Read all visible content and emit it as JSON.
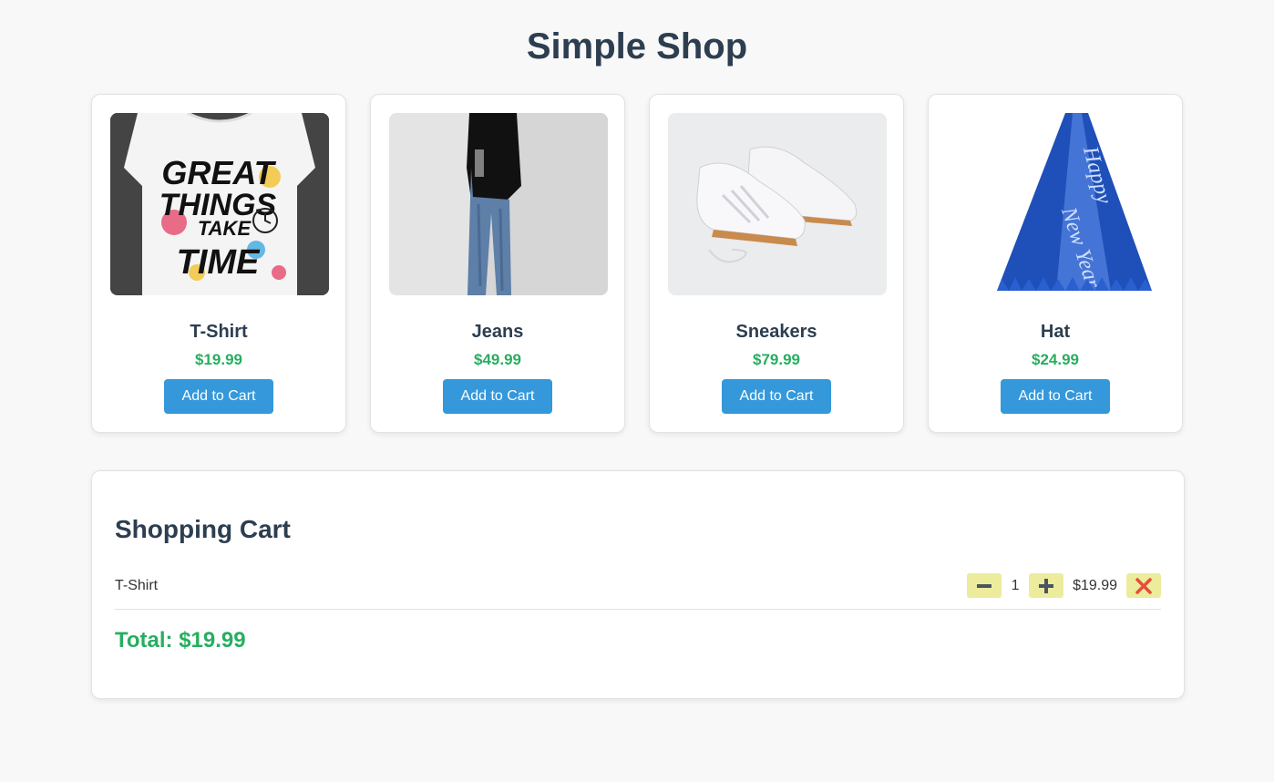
{
  "shop": {
    "title": "Simple Shop"
  },
  "products": [
    {
      "name": "T-Shirt",
      "price": "$19.99",
      "button": "Add to Cart",
      "image_text": [
        "GREAT",
        "THINGS",
        "TAKE",
        "TIME"
      ]
    },
    {
      "name": "Jeans",
      "price": "$49.99",
      "button": "Add to Cart"
    },
    {
      "name": "Sneakers",
      "price": "$79.99",
      "button": "Add to Cart"
    },
    {
      "name": "Hat",
      "price": "$24.99",
      "button": "Add to Cart",
      "image_text": [
        "Happy",
        "New Year"
      ]
    }
  ],
  "cart": {
    "title": "Shopping Cart",
    "items": [
      {
        "name": "T-Shirt",
        "quantity": "1",
        "price": "$19.99"
      }
    ],
    "total": "Total: $19.99"
  },
  "icons": {
    "decrease": "minus-icon",
    "increase": "plus-icon",
    "remove": "close-icon"
  },
  "colors": {
    "title": "#2c3e50",
    "price": "#27ae60",
    "button": "#3498db",
    "qty_button": "#ecec9c",
    "remove": "#e74c3c"
  }
}
